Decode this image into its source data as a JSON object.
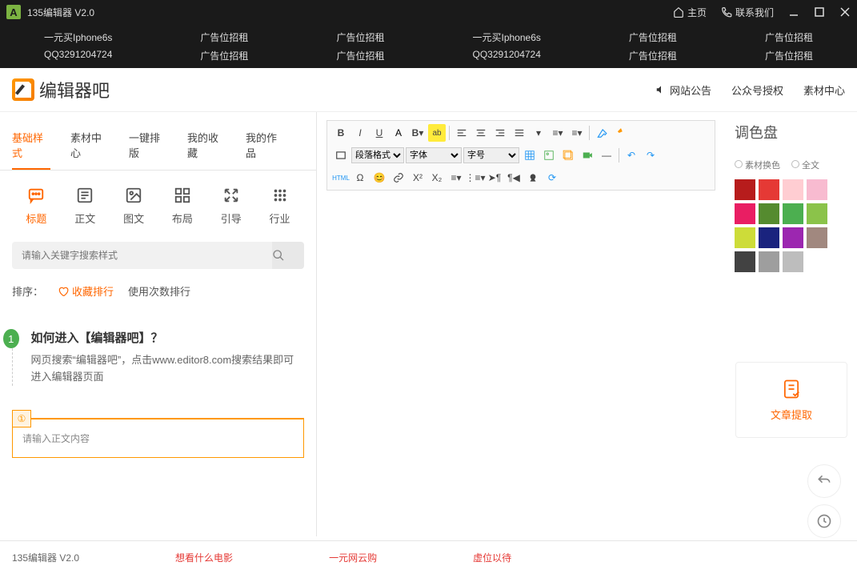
{
  "titlebar": {
    "title": "135编辑器  V2.0",
    "home": "主页",
    "contact": "联系我们"
  },
  "ads": [
    {
      "l1": "一元买Iphone6s",
      "l2": "QQ3291204724"
    },
    {
      "l1": "广告位招租",
      "l2": "广告位招租"
    },
    {
      "l1": "广告位招租",
      "l2": "广告位招租"
    },
    {
      "l1": "一元买Iphone6s",
      "l2": "QQ3291204724"
    },
    {
      "l1": "广告位招租",
      "l2": "广告位招租"
    },
    {
      "l1": "广告位招租",
      "l2": "广告位招租"
    }
  ],
  "header": {
    "brand": "编辑器吧",
    "nav": [
      "网站公告",
      "公众号授权",
      "素材中心"
    ]
  },
  "tabs": [
    "基础样式",
    "素材中心",
    "一键排版",
    "我的收藏",
    "我的作品"
  ],
  "categories": [
    {
      "label": "标题"
    },
    {
      "label": "正文"
    },
    {
      "label": "图文"
    },
    {
      "label": "布局"
    },
    {
      "label": "引导"
    },
    {
      "label": "行业"
    }
  ],
  "search": {
    "placeholder": "请输入关键字搜索样式"
  },
  "sort": {
    "label": "排序：",
    "opt1": "收藏排行",
    "opt2": "使用次数排行"
  },
  "card": {
    "badge": "1",
    "title": "如何进入【编辑器吧】？",
    "desc": "网页搜索“编辑器吧”，点击www.editor8.com搜索结果即可进入编辑器页面"
  },
  "textcard": {
    "placeholder": "请输入正文内容"
  },
  "editor": {
    "format_sel": "段落格式",
    "font_sel": "字体",
    "size_sel": "字号"
  },
  "right": {
    "title": "调色盘",
    "t1": "素材换色",
    "t2": "全文"
  },
  "palette": [
    "#b71c1c",
    "#e53935",
    "#ffcdd2",
    "#f8bbd0",
    "#e91e63",
    "#558b2f",
    "#4caf50",
    "#8bc34a",
    "#cddc39",
    "#1a237e",
    "#9c27b0",
    "#a1887f",
    "#424242",
    "#9e9e9e",
    "#bdbdbd"
  ],
  "extract": {
    "label": "文章提取"
  },
  "status": {
    "ver": "135编辑器  V2.0",
    "a": "想看什么电影",
    "b": "一元网云购",
    "c": "虚位以待"
  }
}
